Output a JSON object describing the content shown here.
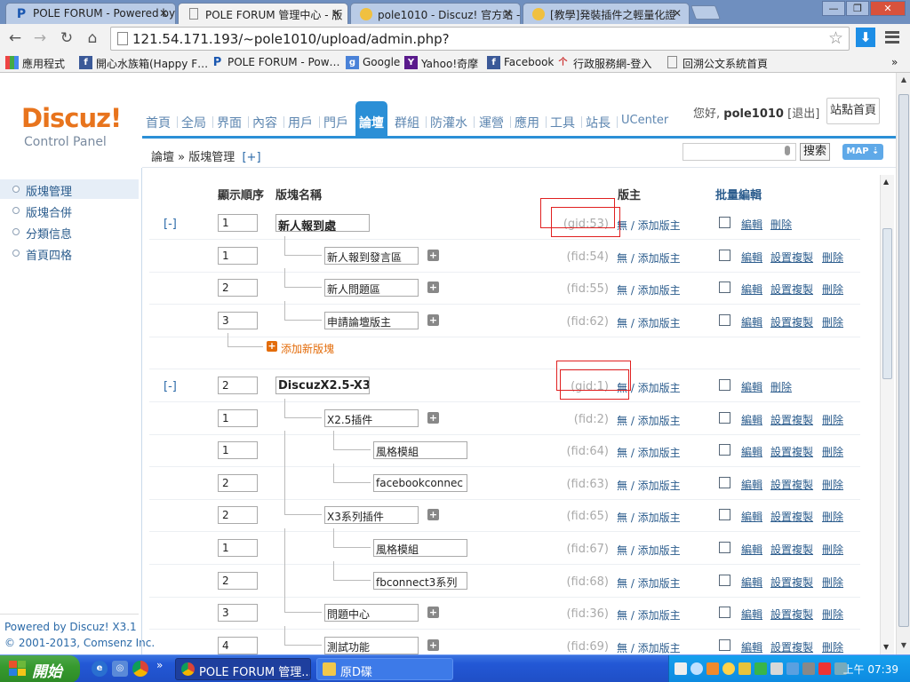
{
  "browser": {
    "tabs": [
      {
        "title": "POLE FORUM - Powered by",
        "icon": "P",
        "color": "#1a57b0"
      },
      {
        "title": "POLE FORUM 管理中心 - 版",
        "icon": "page",
        "color": "#777"
      },
      {
        "title": "pole1010 - Discuz! 官方站 -",
        "icon": "discuz",
        "color": "#e8b020"
      },
      {
        "title": "[教學]発裝插件之輕量化證",
        "icon": "discuz",
        "color": "#e8b020"
      }
    ],
    "url": "121.54.171.193/~pole1010/upload/admin.php?",
    "bookmarks": [
      {
        "label": "應用程式",
        "icon": "apps-icon"
      },
      {
        "label": "開心水族箱(Happy F…",
        "icon": "facebook-icon"
      },
      {
        "label": "POLE FORUM - Pow…",
        "icon": "p-icon"
      },
      {
        "label": "Google",
        "icon": "google-icon"
      },
      {
        "label": "Yahoo!奇摩",
        "icon": "yahoo-icon"
      },
      {
        "label": "Facebook",
        "icon": "facebook-icon"
      },
      {
        "label": "行政服務網-登入",
        "icon": "gov-icon"
      },
      {
        "label": "回溯公文系統首頁",
        "icon": "page-icon"
      }
    ],
    "bookmarks_more": "»"
  },
  "header": {
    "logo_main": "Discuz!",
    "logo_sub": "Control Panel",
    "nav": [
      "首頁",
      "全局",
      "界面",
      "內容",
      "用戶",
      "門戶",
      "論壇",
      "群組",
      "防灌水",
      "運營",
      "應用",
      "工具",
      "站長",
      "UCenter"
    ],
    "nav_active": "論壇",
    "greeting": "您好,",
    "username": "pole1010",
    "logout": "[退出]",
    "home_button": "站點首頁"
  },
  "breadcrumb": {
    "path": "論壇 » 版塊管理",
    "add": "[+]",
    "search_button": "搜索",
    "map_button": "MAP ⇣"
  },
  "sidebar": {
    "items": [
      "版塊管理",
      "版塊合併",
      "分類信息",
      "首頁四格"
    ],
    "active": "版塊管理",
    "powered": "Powered by",
    "powered_link": "Discuz! X3.1",
    "copyright": "© 2001-2013,",
    "copyright_link": "Comsenz Inc."
  },
  "table": {
    "headers": {
      "order": "顯示順序",
      "name": "版塊名稱",
      "moderator": "版主",
      "batch": "批量編輯"
    },
    "actions": {
      "edit": "編輯",
      "copy": "設置複製",
      "delete": "刪除"
    },
    "moderator_text": "無 / 添加版主",
    "add_forum": "添加新版塊",
    "rows": [
      {
        "type": "group",
        "toggle": "[-]",
        "order": "1",
        "name": "新人報到處",
        "id": "(gid:53)"
      },
      {
        "type": "forum",
        "level": 1,
        "order": "1",
        "name": "新人報到發言區",
        "id": "(fid:54)"
      },
      {
        "type": "forum",
        "level": 1,
        "order": "2",
        "name": "新人問題區",
        "id": "(fid:55)"
      },
      {
        "type": "forum",
        "level": 1,
        "order": "3",
        "name": "申請論壇版主",
        "id": "(fid:62)"
      },
      {
        "type": "add"
      },
      {
        "type": "group",
        "toggle": "[-]",
        "order": "2",
        "name": "DiscuzX2.5-X3.",
        "id": "(gid:1)"
      },
      {
        "type": "forum",
        "level": 1,
        "order": "1",
        "name": "X2.5插件",
        "id": "(fid:2)"
      },
      {
        "type": "forum",
        "level": 2,
        "order": "1",
        "name": "風格模組",
        "id": "(fid:64)"
      },
      {
        "type": "forum",
        "level": 2,
        "order": "2",
        "name": "facebookconnec",
        "id": "(fid:63)"
      },
      {
        "type": "forum",
        "level": 1,
        "order": "2",
        "name": "X3系列插件",
        "id": "(fid:65)"
      },
      {
        "type": "forum",
        "level": 2,
        "order": "1",
        "name": "風格模組",
        "id": "(fid:67)"
      },
      {
        "type": "forum",
        "level": 2,
        "order": "2",
        "name": "fbconnect3系列",
        "id": "(fid:68)"
      },
      {
        "type": "forum",
        "level": 1,
        "order": "3",
        "name": "問題中心",
        "id": "(fid:36)"
      },
      {
        "type": "forum",
        "level": 1,
        "order": "4",
        "name": "測試功能",
        "id": "(fid:69)"
      }
    ]
  },
  "taskbar": {
    "start": "開始",
    "tasks": [
      {
        "label": "POLE FORUM 管理...",
        "active": true
      },
      {
        "label": "原D碟",
        "active": false
      }
    ],
    "clock": "上午 07:39"
  },
  "colors": {
    "accent": "#2b8fd6",
    "link": "#2b5c8d",
    "orange": "#e36c0a",
    "highlight": "#e02020"
  }
}
